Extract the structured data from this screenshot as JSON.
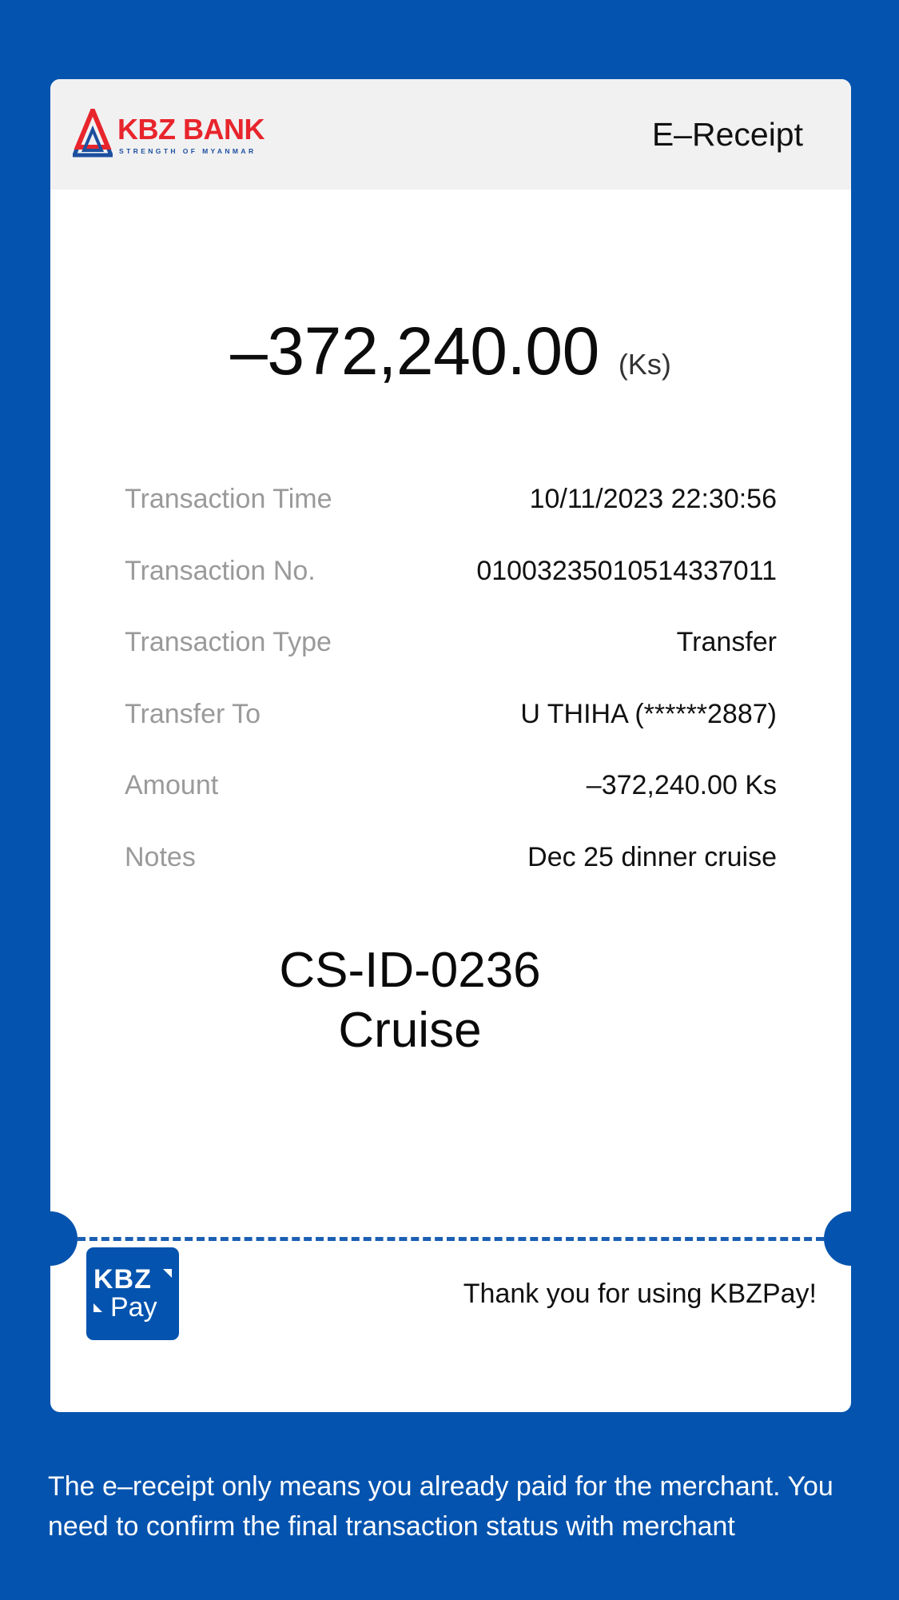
{
  "colors": {
    "background": "#0453ae",
    "card": "#ffffff",
    "header": "#f1f1f2",
    "bank_red": "#e8252c",
    "bank_blue": "#1d4f9f",
    "label_gray": "#9a9a9a"
  },
  "header": {
    "logo_text": "KBZ BANK",
    "logo_tagline": "STRENGTH OF MYANMAR",
    "logo_icon": "kbz-triangle-logo-icon",
    "title": "E–Receipt"
  },
  "amount": {
    "value": "–372,240.00",
    "unit": "(Ks)"
  },
  "details": [
    {
      "label": "Transaction Time",
      "value": "10/11/2023 22:30:56"
    },
    {
      "label": "Transaction No.",
      "value": "01003235010514337011"
    },
    {
      "label": "Transaction Type",
      "value": "Transfer"
    },
    {
      "label": "Transfer To",
      "value": "U THIHA (******2887)"
    },
    {
      "label": "Amount",
      "value": "–372,240.00 Ks"
    },
    {
      "label": "Notes",
      "value": "Dec 25 dinner cruise"
    }
  ],
  "stamp": {
    "line1": "CS-ID-0236",
    "line2": "Cruise"
  },
  "footer_card": {
    "pay_logo_top": "KBZ",
    "pay_logo_bottom": "Pay",
    "pay_logo_icon": "kbzpay-logo-icon",
    "thanks": "Thank you for using KBZPay!"
  },
  "footnote": "The e–receipt only means you already paid for the merchant. You need to confirm the final transaction status with merchant"
}
